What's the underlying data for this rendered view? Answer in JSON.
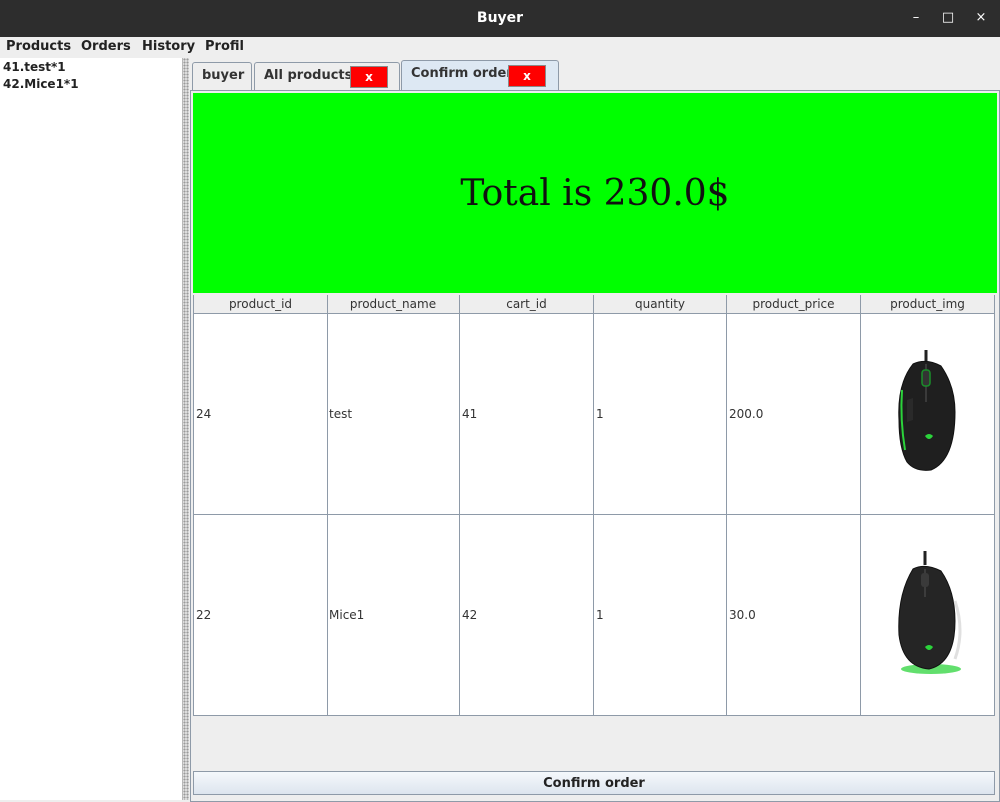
{
  "window": {
    "title": "Buyer",
    "controls": [
      "–",
      "□",
      "×"
    ]
  },
  "menubar": [
    "Products",
    "Orders",
    "History",
    "Profil"
  ],
  "cart_items": [
    "41.test*1",
    "42.Mice1*1"
  ],
  "tabs": [
    {
      "label": "buyer"
    },
    {
      "label": "All products",
      "close": "x"
    },
    {
      "label": "Confirm order",
      "close": "x"
    }
  ],
  "total_text": "Total is 230.0$",
  "table": {
    "columns": [
      "product_id",
      "product_name",
      "cart_id",
      "quantity",
      "product_price",
      "product_img"
    ],
    "rows": [
      [
        "24",
        "test",
        "41",
        "1",
        "200.0"
      ],
      [
        "22",
        "Mice1",
        "42",
        "1",
        "30.0"
      ]
    ]
  },
  "confirm_button": "Confirm order",
  "colors": {
    "banner": "#00ff00",
    "close_button": "#ff0000",
    "titlebar": "#2d2d2d"
  }
}
